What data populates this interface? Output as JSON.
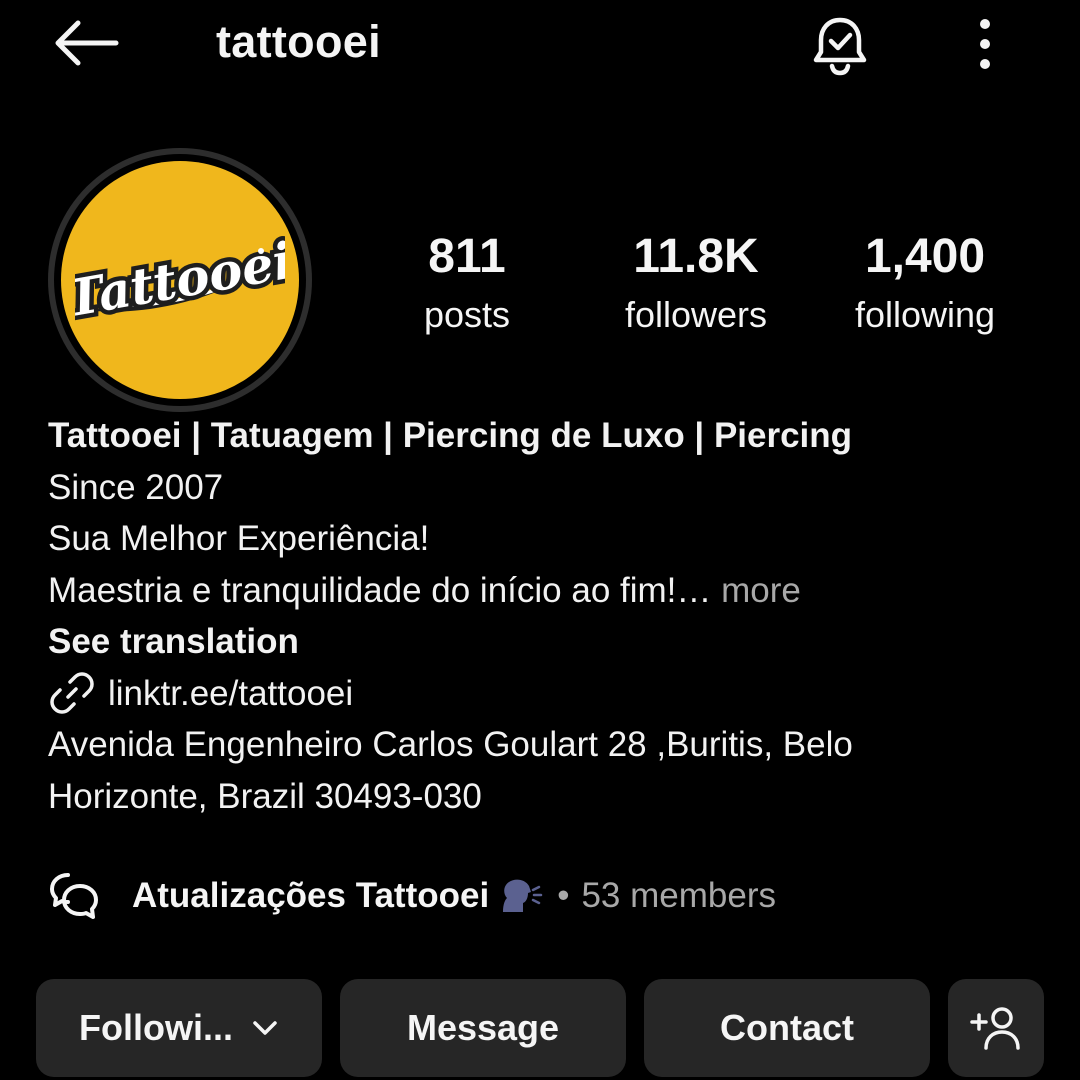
{
  "header": {
    "username": "tattooei",
    "back_icon": "back-arrow-icon",
    "bell_icon": "bell-check-icon",
    "more_icon": "vertical-dots-icon"
  },
  "profile": {
    "avatar_text": "Tattooei",
    "avatar_color": "#f0b71c",
    "stats": {
      "posts": {
        "value": "811",
        "label": "posts"
      },
      "followers": {
        "value": "11.8K",
        "label": "followers"
      },
      "following": {
        "value": "1,400",
        "label": "following"
      }
    }
  },
  "bio": {
    "name": "Tattooei | Tatuagem | Piercing de Luxo | Piercing",
    "line1": "Since 2007",
    "line2": "Sua Melhor Experiência!",
    "line3": "Maestria e tranquilidade do início ao fim!",
    "ellipsis": "…",
    "more": "more",
    "see_translation": "See translation",
    "link": "linktr.ee/tattooei",
    "address_line1": "Avenida Engenheiro Carlos Goulart 28 ,Buritis, Belo",
    "address_line2": "Horizonte, Brazil 30493-030"
  },
  "channel": {
    "name": "Atualizações Tattooei",
    "separator": "•",
    "members": "53 members",
    "icon": "chat-bubbles-icon",
    "emoji": "speaking-head-emoji"
  },
  "actions": {
    "following_label": "Followi...",
    "message_label": "Message",
    "contact_label": "Contact",
    "add_user_icon": "add-user-icon"
  },
  "colors": {
    "background": "#000000",
    "button_bg": "#262626",
    "muted_text": "#a8a8a8",
    "accent_yellow": "#f0b71c"
  }
}
